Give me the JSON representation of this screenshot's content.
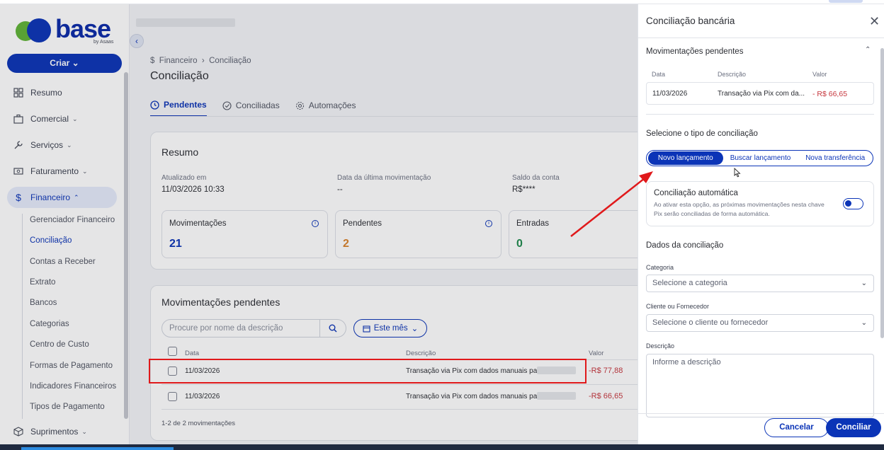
{
  "colors": {
    "brand": "#0b34b7",
    "negative": "#c6373e",
    "highlight": "#e0191b",
    "positive": "#1e8a4c"
  },
  "logo": {
    "word": "base",
    "by": "by Asaas"
  },
  "sidebar": {
    "create_label": "Criar",
    "items": [
      {
        "label": "Resumo",
        "icon": "dashboard-icon"
      },
      {
        "label": "Comercial",
        "icon": "briefcase-icon"
      },
      {
        "label": "Serviços",
        "icon": "wrench-icon"
      },
      {
        "label": "Faturamento",
        "icon": "invoice-icon"
      },
      {
        "label": "Financeiro",
        "icon": "dollar-icon"
      },
      {
        "label": "Suprimentos",
        "icon": "box-icon"
      }
    ],
    "financeiro_sub": [
      "Gerenciador Financeiro",
      "Conciliação",
      "Contas a Receber",
      "Extrato",
      "Bancos",
      "Categorias",
      "Centro de Custo",
      "Formas de Pagamento",
      "Indicadores Financeiros",
      "Tipos de Pagamento"
    ]
  },
  "breadcrumb": {
    "root": "Financeiro",
    "current": "Conciliação"
  },
  "page_title": "Conciliação",
  "tabs": [
    "Pendentes",
    "Conciliadas",
    "Automações"
  ],
  "resumo": {
    "title": "Resumo",
    "updated_label": "Atualizado em",
    "updated_value": "11/03/2026 10:33",
    "last_mov_label": "Data da última movimentação",
    "last_mov_value": "--",
    "balance_label": "Saldo da conta",
    "balance_value": "R$****",
    "stats": [
      {
        "label": "Movimentações",
        "value": "21",
        "color": "#0b34b7"
      },
      {
        "label": "Pendentes",
        "value": "2",
        "color": "#d9822b"
      },
      {
        "label": "Entradas",
        "value": "0",
        "color": "#1e8a4c"
      }
    ]
  },
  "pending": {
    "title": "Movimentações pendentes",
    "search_placeholder": "Procure por nome da descrição",
    "filter_label": "Este mês",
    "columns": [
      "Data",
      "Descrição",
      "Valor"
    ],
    "rows": [
      {
        "date": "11/03/2026",
        "desc": "Transação via Pix com dados manuais para",
        "value": "-R$ 77,88"
      },
      {
        "date": "11/03/2026",
        "desc": "Transação via Pix com dados manuais para",
        "value": "-R$ 66,65"
      }
    ],
    "footer": "1-2 de 2 movimentações"
  },
  "panel": {
    "title": "Conciliação bancária",
    "mov_title": "Movimentações pendentes",
    "mov_columns": [
      "Data",
      "Descrição",
      "Valor"
    ],
    "mov_row": {
      "date": "11/03/2026",
      "desc": "Transação via Pix com da...",
      "value": "- R$ 66,65"
    },
    "select_title": "Selecione o tipo de conciliação",
    "options": [
      "Novo lançamento",
      "Buscar lançamento",
      "Nova transferência"
    ],
    "auto_title": "Conciliação automática",
    "auto_desc": "Ao ativar esta opção, as próximas movimentações nesta chave Pix serão conciliadas de forma automática.",
    "dados_title": "Dados da conciliação",
    "category_label": "Categoria",
    "category_placeholder": "Selecione a categoria",
    "client_label": "Cliente ou Fornecedor",
    "client_placeholder": "Selecione o cliente ou fornecedor",
    "desc_label": "Descrição",
    "desc_placeholder": "Informe a descrição",
    "cancel_label": "Cancelar",
    "confirm_label": "Conciliar"
  }
}
